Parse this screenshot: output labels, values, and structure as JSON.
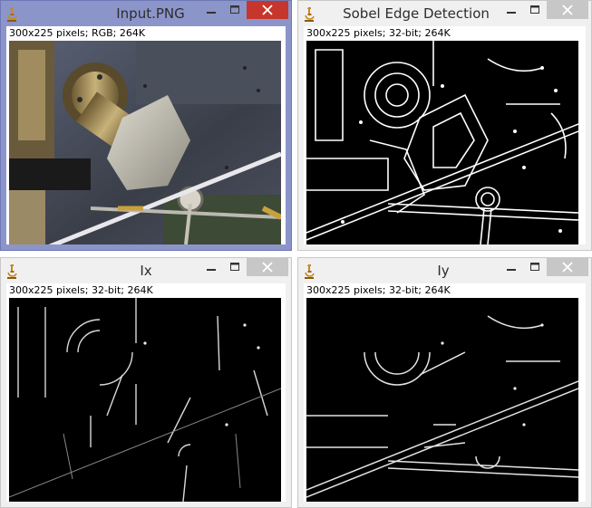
{
  "windows": {
    "input": {
      "title": "Input.PNG",
      "info": "300x225 pixels; RGB; 264K",
      "icon": "microscope-icon"
    },
    "sobel": {
      "title": "Sobel Edge Detection",
      "info": "300x225 pixels; 32-bit; 264K",
      "icon": "microscope-icon"
    },
    "ix": {
      "title": "Ix",
      "info": "300x225 pixels; 32-bit; 264K",
      "icon": "microscope-icon"
    },
    "iy": {
      "title": "Iy",
      "info": "300x225 pixels; 32-bit; 264K",
      "icon": "microscope-icon"
    }
  },
  "colors": {
    "active_frame": "#8c95c9",
    "close_active": "#c7362c",
    "close_inactive": "#c7c7c7",
    "edge_background": "#000000"
  }
}
